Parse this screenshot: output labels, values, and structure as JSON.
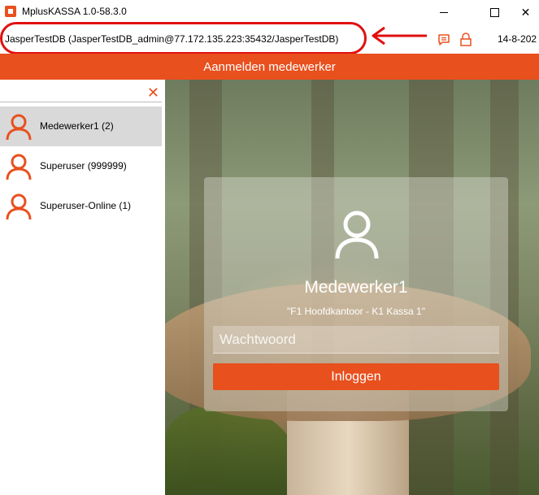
{
  "window": {
    "title": "MplusKASSA 1.0-58.3.0",
    "close_glyph": "✕"
  },
  "infobar": {
    "connection": "JasperTestDB (JasperTestDB_admin@77.172.135.223:35432/JasperTestDB)",
    "date": "14-8-202",
    "icons": [
      "chat-icon",
      "lock-icon"
    ]
  },
  "header": {
    "title": "Aanmelden medewerker"
  },
  "sidebar": {
    "search_value": "",
    "clear_glyph": "✕",
    "users": [
      {
        "label": "Medewerker1 (2)",
        "selected": true
      },
      {
        "label": "Superuser (999999)",
        "selected": false
      },
      {
        "label": "Superuser-Online (1)",
        "selected": false
      }
    ]
  },
  "login": {
    "name": "Medewerker1",
    "location": "\"F1 Hoofdkantoor - K1 Kassa 1\"",
    "password_placeholder": "Wachtwoord",
    "button": "Inloggen"
  },
  "colors": {
    "accent": "#e8501e",
    "annotation_red": "#e01010",
    "selected_row": "#d9d9d9"
  }
}
